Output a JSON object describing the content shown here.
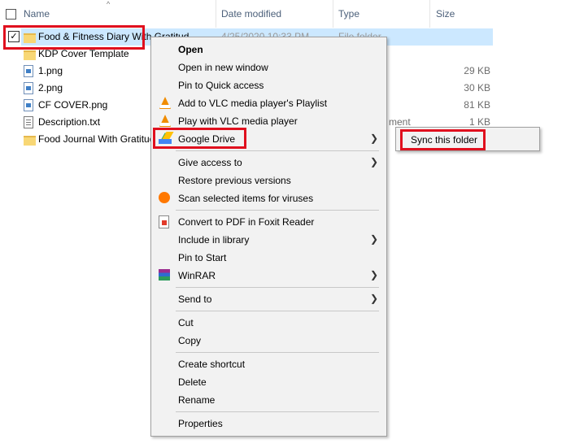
{
  "header": {
    "name": "Name",
    "date_modified": "Date modified",
    "type": "Type",
    "size": "Size"
  },
  "rows": [
    {
      "name": "Food & Fitness Diary With Gratitud",
      "date": "4/25/2020 10:33 PM",
      "type": "File folder",
      "size": "",
      "icon": "folder-icon",
      "selected": true
    },
    {
      "name": "KDP Cover Template",
      "date": "",
      "type": "",
      "size": "",
      "icon": "folder-icon"
    },
    {
      "name": "1.png",
      "date": "",
      "type": "",
      "size": "29 KB",
      "icon": "image-file-icon"
    },
    {
      "name": "2.png",
      "date": "",
      "type": "",
      "size": "30 KB",
      "icon": "image-file-icon"
    },
    {
      "name": "CF COVER.png",
      "date": "",
      "type": "",
      "size": "81 KB",
      "icon": "image-file-icon"
    },
    {
      "name": "Description.txt",
      "date": "",
      "type": "ment",
      "size": "1 KB",
      "icon": "text-file-icon"
    },
    {
      "name": "Food Journal With Gratitude",
      "date": "",
      "type": "",
      "size": "",
      "icon": "folder-icon"
    }
  ],
  "context_menu": {
    "open": "Open",
    "open_new_window": "Open in new window",
    "pin_quick_access": "Pin to Quick access",
    "vlc_playlist": "Add to VLC media player's Playlist",
    "vlc_play": "Play with VLC media player",
    "google_drive": "Google Drive",
    "give_access": "Give access to",
    "restore_versions": "Restore previous versions",
    "scan_viruses": "Scan selected items for viruses",
    "convert_pdf": "Convert to PDF in Foxit Reader",
    "include_library": "Include in library",
    "pin_start": "Pin to Start",
    "winrar": "WinRAR",
    "send_to": "Send to",
    "cut": "Cut",
    "copy": "Copy",
    "create_shortcut": "Create shortcut",
    "delete": "Delete",
    "rename": "Rename",
    "properties": "Properties"
  },
  "submenu": {
    "sync_folder": "Sync this folder"
  },
  "colors": {
    "highlight": "#e0101e",
    "selection": "#cce8ff",
    "menu_bg": "#f2f2f2"
  }
}
